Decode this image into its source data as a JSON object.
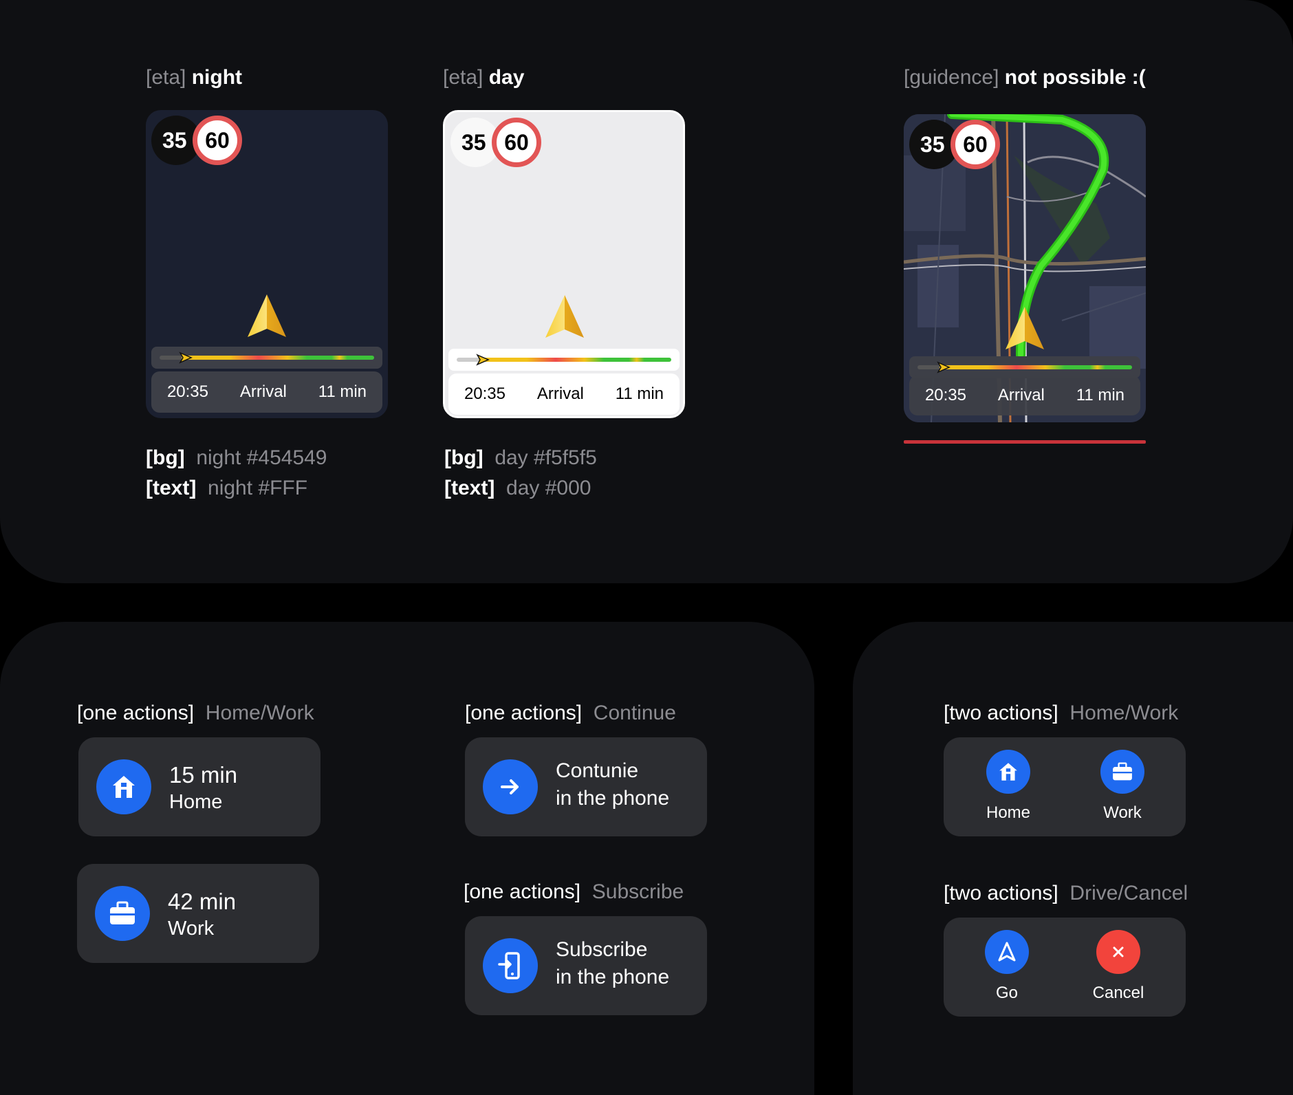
{
  "eta_night": {
    "caption_tag": "[eta]",
    "caption_name": "night",
    "speed_current": "35",
    "speed_limit": "60",
    "time": "20:35",
    "label": "Arrival",
    "duration": "11 min",
    "spec_bg_key": "[bg]",
    "spec_bg_val": "night #454549",
    "spec_text_key": "[text]",
    "spec_text_val": "night #FFF"
  },
  "eta_day": {
    "caption_tag": "[eta]",
    "caption_name": "day",
    "speed_current": "35",
    "speed_limit": "60",
    "time": "20:35",
    "label": "Arrival",
    "duration": "11 min",
    "spec_bg_key": "[bg]",
    "spec_bg_val": "day #f5f5f5",
    "spec_text_key": "[text]",
    "spec_text_val": "day #000"
  },
  "guidance": {
    "caption_tag": "[guidence]",
    "caption_name": "not possible :(",
    "speed_current": "35",
    "speed_limit": "60",
    "time": "20:35",
    "label": "Arrival",
    "duration": "11 min"
  },
  "one_home_work": {
    "caption_tag": "[one actions]",
    "caption_name": "Home/Work",
    "home_time": "15 min",
    "home_label": "Home",
    "work_time": "42 min",
    "work_label": "Work"
  },
  "one_continue": {
    "caption_tag": "[one actions]",
    "caption_name": "Continue",
    "line1": "Contunie",
    "line2": "in the phone"
  },
  "one_subscribe": {
    "caption_tag": "[one actions]",
    "caption_name": "Subscribe",
    "line1": "Subscribe",
    "line2": "in the phone"
  },
  "two_home_work": {
    "caption_tag": "[two actions]",
    "caption_name": "Home/Work",
    "left_label": "Home",
    "right_label": "Work"
  },
  "two_drive_cancel": {
    "caption_tag": "[two actions]",
    "caption_name": "Drive/Cancel",
    "left_label": "Go",
    "right_label": "Cancel"
  },
  "colors": {
    "accent_blue": "#1f6af0",
    "cancel_red": "#f2443c",
    "night_bg": "#454549",
    "day_bg": "#f5f5f5"
  }
}
